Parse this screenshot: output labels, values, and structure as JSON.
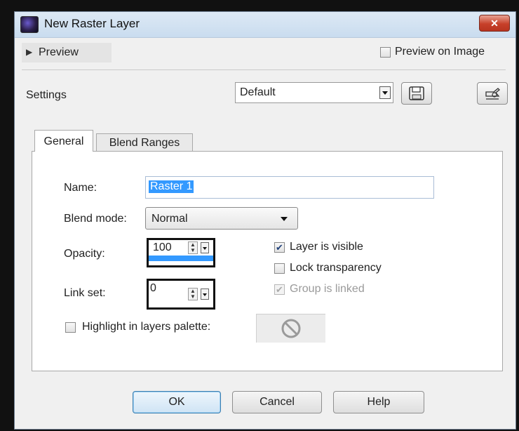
{
  "window": {
    "title": "New Raster Layer",
    "close_glyph": "✕"
  },
  "preview": {
    "label": "Preview",
    "preview_on_image_label": "Preview on Image",
    "preview_on_image_checked": false
  },
  "settings": {
    "label": "Settings",
    "preset_value": "Default"
  },
  "tabs": [
    {
      "label": "General",
      "active": true
    },
    {
      "label": "Blend Ranges",
      "active": false
    }
  ],
  "general": {
    "name_label": "Name:",
    "name_value": "Raster 1",
    "blend_mode_label": "Blend mode:",
    "blend_mode_value": "Normal",
    "opacity_label": "Opacity:",
    "opacity_value": "100",
    "link_set_label": "Link set:",
    "link_set_value": "0",
    "layer_visible_label": "Layer is visible",
    "layer_visible_checked": true,
    "lock_transparency_label": "Lock transparency",
    "lock_transparency_checked": false,
    "group_linked_label": "Group is linked",
    "group_linked_checked": true,
    "group_linked_enabled": false,
    "highlight_label": "Highlight in layers palette:",
    "highlight_checked": false
  },
  "buttons": {
    "ok": "OK",
    "cancel": "Cancel",
    "help": "Help"
  },
  "colors": {
    "title_gradient_top": "#dde9f5",
    "close_red": "#c7402a",
    "selection_blue": "#3399ff",
    "check_blue": "#22427a"
  },
  "icons": {
    "app": "paint-shop-pro-icon",
    "save": "save-preset-icon",
    "reset": "reset-settings-icon",
    "no_color": "no-color-icon"
  }
}
